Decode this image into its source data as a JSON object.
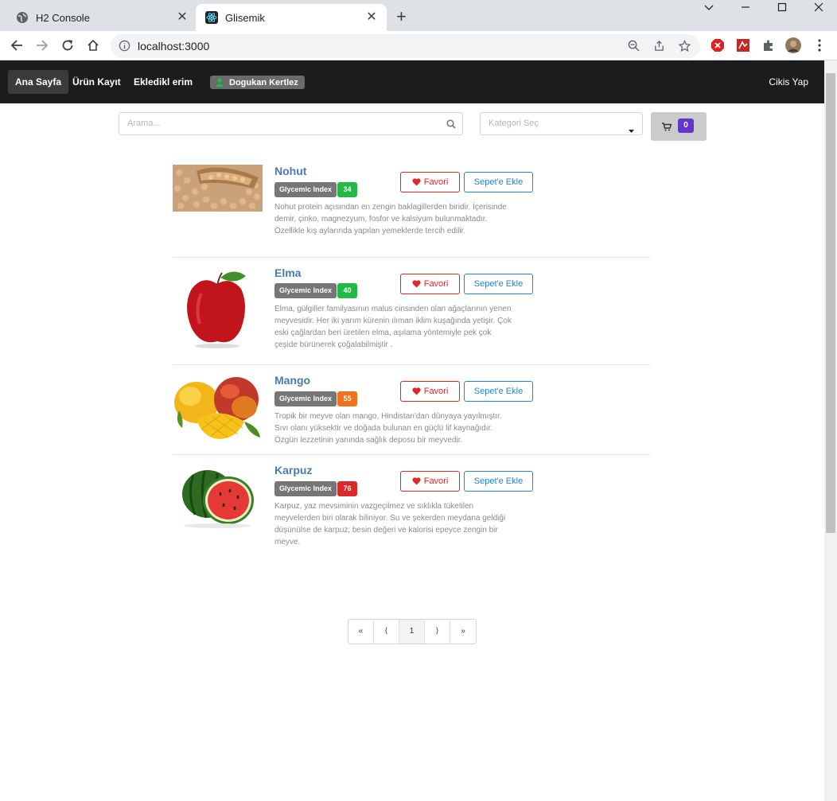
{
  "browser": {
    "tabs": [
      {
        "title": "H2 Console"
      },
      {
        "title": "Glisemik"
      }
    ],
    "url": "localhost:3000"
  },
  "navbar": {
    "home": "Ana Sayfa",
    "register": "Ürün Kayıt",
    "added": "Ekledikl erim",
    "user": "Dogukan Kertlez",
    "logout": "Cikis Yap"
  },
  "search": {
    "placeholder": "Arama..."
  },
  "category": {
    "placeholder": "Kategori Seç"
  },
  "cart": {
    "count": "0"
  },
  "products": [
    {
      "name": "Nohut",
      "gi_label": "Glycemic Index",
      "gi": "34",
      "gi_color": "#21ba45",
      "fav": "Favori",
      "add": "Sepet'e Ekle",
      "desc": "Nohut protein açısından en zengin baklagillerden biridir. İçerisinde demir, çinko, magnezyum, fosfor ve kalsiyum bulunmaktadır. Özellikle kış aylarında yapılan yemeklerde tercih edilir."
    },
    {
      "name": "Elma",
      "gi_label": "Glycemic Index",
      "gi": "40",
      "gi_color": "#21ba45",
      "fav": "Favori",
      "add": "Sepet'e Ekle",
      "desc": "Elma, gülgiller familyasının malus cinsinden olan ağaçlarının yenen meyvesidir. Her iki yarım kürenin ılıman iklim kuşağında yetişir. Çok eski çağlardan beri üretilen elma, aşılama yöntemiyle pek çok çeşide bürünerek çoğalabilmiştir ."
    },
    {
      "name": "Mango",
      "gi_label": "Glycemic Index",
      "gi": "55",
      "gi_color": "#f2711c",
      "fav": "Favori",
      "add": "Sepet'e Ekle",
      "desc": "Tropik bir meyve olan mango, Hindistan'dan dünyaya yayılmıştır. Sıvı olanı yüksektir ve doğada bulunan en güçlü lif kaynağıdır. Özgün lezzetinin yanında sağlık deposu bir meyvedir."
    },
    {
      "name": "Karpuz",
      "gi_label": "Glycemic Index",
      "gi": "76",
      "gi_color": "#db2828",
      "fav": "Favori",
      "add": "Sepet'e Ekle",
      "desc": "Karpuz, yaz mevsiminin vazgeçilmez ve sıklıkla tüketilen meyvelerden biri olarak biliniyor. Su ve şekerden meydana geldiği düşünülse de karpuz; besin değeri ve kalorisi epeyce zengin bir meyve."
    }
  ],
  "pagination": [
    "«",
    "⟨",
    "1",
    "⟩",
    "»"
  ]
}
